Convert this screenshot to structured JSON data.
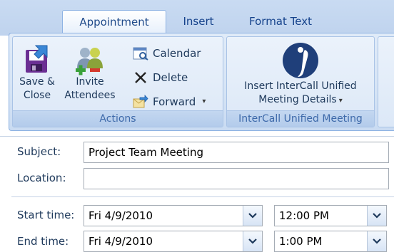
{
  "tabs": [
    {
      "label": "Appointment",
      "active": true
    },
    {
      "label": "Insert",
      "active": false
    },
    {
      "label": "Format Text",
      "active": false
    }
  ],
  "groups": {
    "actions": {
      "label": "Actions",
      "save_close": [
        "Save &",
        "Close"
      ],
      "invite_attendees": [
        "Invite",
        "Attendees"
      ],
      "calendar": "Calendar",
      "delete": "Delete",
      "forward": "Forward"
    },
    "intercall": {
      "label": "InterCall Unified Meeting",
      "insert_line1": "Insert InterCall Unified",
      "insert_line2": "Meeting Details"
    }
  },
  "form": {
    "subject_label": "Subject:",
    "subject_value": "Project Team Meeting",
    "location_label": "Location:",
    "location_value": "",
    "start_label": "Start time:",
    "start_date": "Fri 4/9/2010",
    "start_time": "12:00 PM",
    "end_label": "End time:",
    "end_date": "Fri 4/9/2010",
    "end_time": "1:00 PM"
  },
  "colors": {
    "ribbon": "#d6e4f5",
    "group_label": "#3e6aaa",
    "text": "#1e395b"
  }
}
